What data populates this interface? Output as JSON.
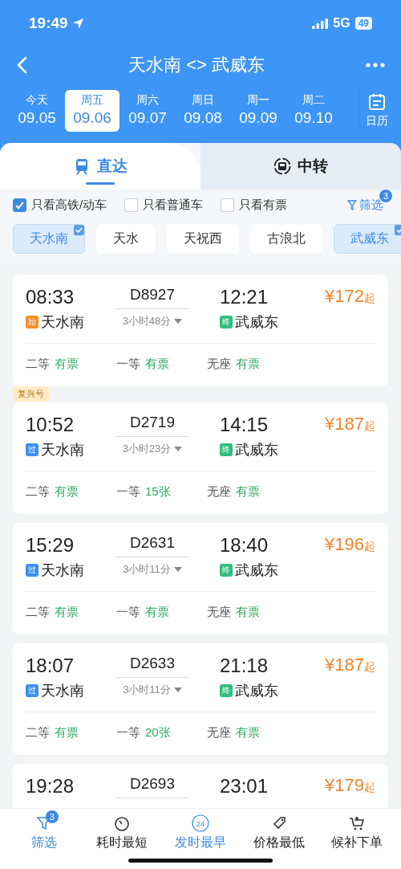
{
  "status_bar": {
    "time": "19:49",
    "network": "5G",
    "battery": "49"
  },
  "nav": {
    "title": "天水南 <> 武威东"
  },
  "dates": [
    {
      "weekday": "今天",
      "date": "09.05",
      "selected": false
    },
    {
      "weekday": "周五",
      "date": "09.06",
      "selected": true
    },
    {
      "weekday": "周六",
      "date": "09.07",
      "selected": false
    },
    {
      "weekday": "周日",
      "date": "09.08",
      "selected": false
    },
    {
      "weekday": "周一",
      "date": "09.09",
      "selected": false
    },
    {
      "weekday": "周二",
      "date": "09.10",
      "selected": false
    }
  ],
  "calendar_label": "日历",
  "tabs": [
    {
      "label": "直达",
      "selected": true
    },
    {
      "label": "中转",
      "selected": false
    }
  ],
  "filters": [
    {
      "label": "只看高铁/动车",
      "checked": true
    },
    {
      "label": "只看普通车",
      "checked": false
    },
    {
      "label": "只看有票",
      "checked": false
    }
  ],
  "filter_button": {
    "label": "筛选",
    "badge": "3"
  },
  "stations": [
    {
      "label": "天水南",
      "selected": true
    },
    {
      "label": "天水",
      "selected": false
    },
    {
      "label": "天祝西",
      "selected": false
    },
    {
      "label": "古浪北",
      "selected": false
    },
    {
      "label": "武威东",
      "selected": true
    }
  ],
  "trains": [
    {
      "depart": "08:33",
      "number": "D8927",
      "arrive": "12:21",
      "price": "¥172",
      "price_suffix": "起",
      "from_tag": {
        "text": "始",
        "color": "#f0902a"
      },
      "from": "天水南",
      "duration": "3小时48分",
      "to_tag": {
        "text": "终",
        "color": "#2ebf7e"
      },
      "to": "武威东",
      "seats": [
        {
          "class": "二等",
          "status": "有票"
        },
        {
          "class": "一等",
          "status": "有票"
        },
        {
          "class": "无座",
          "status": "有票"
        }
      ]
    },
    {
      "badge": "复兴号",
      "depart": "10:52",
      "number": "D2719",
      "arrive": "14:15",
      "price": "¥187",
      "price_suffix": "起",
      "from_tag": {
        "text": "过",
        "color": "#3e8ef0"
      },
      "from": "天水南",
      "duration": "3小时23分",
      "to_tag": {
        "text": "终",
        "color": "#2ebf7e"
      },
      "to": "武威东",
      "seats": [
        {
          "class": "二等",
          "status": "有票"
        },
        {
          "class": "一等",
          "status": "15张"
        },
        {
          "class": "无座",
          "status": "有票"
        }
      ]
    },
    {
      "depart": "15:29",
      "number": "D2631",
      "arrive": "18:40",
      "price": "¥196",
      "price_suffix": "起",
      "from_tag": {
        "text": "过",
        "color": "#3e8ef0"
      },
      "from": "天水南",
      "duration": "3小时11分",
      "to_tag": {
        "text": "终",
        "color": "#2ebf7e"
      },
      "to": "武威东",
      "seats": [
        {
          "class": "二等",
          "status": "有票"
        },
        {
          "class": "一等",
          "status": "有票"
        },
        {
          "class": "无座",
          "status": "有票"
        }
      ]
    },
    {
      "depart": "18:07",
      "number": "D2633",
      "arrive": "21:18",
      "price": "¥187",
      "price_suffix": "起",
      "from_tag": {
        "text": "过",
        "color": "#3e8ef0"
      },
      "from": "天水南",
      "duration": "3小时11分",
      "to_tag": {
        "text": "终",
        "color": "#2ebf7e"
      },
      "to": "武威东",
      "seats": [
        {
          "class": "二等",
          "status": "有票"
        },
        {
          "class": "一等",
          "status": "20张"
        },
        {
          "class": "无座",
          "status": "有票"
        }
      ]
    },
    {
      "depart": "19:28",
      "number": "D2693",
      "arrive": "23:01",
      "price": "¥179",
      "price_suffix": "起"
    }
  ],
  "bottom_bar": [
    {
      "label": "筛选",
      "kind": "filter",
      "badge": "3",
      "selected": true
    },
    {
      "label": "耗时最短",
      "kind": "timer",
      "selected": false
    },
    {
      "label": "发时最早",
      "kind": "clock",
      "icon_text": "24",
      "selected": true
    },
    {
      "label": "价格最低",
      "kind": "tag",
      "selected": false
    },
    {
      "label": "候补下单",
      "kind": "cart",
      "selected": false
    }
  ]
}
